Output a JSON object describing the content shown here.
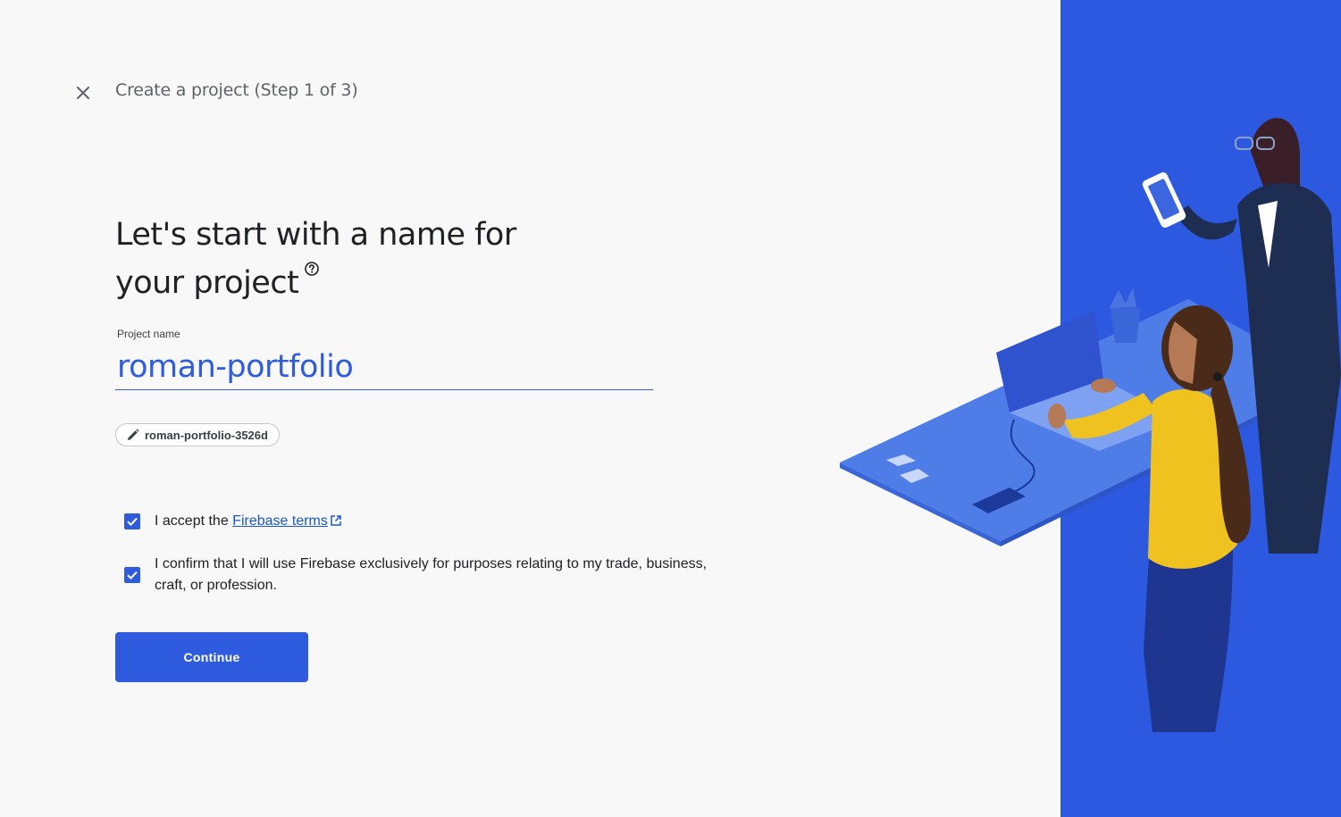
{
  "header": {
    "close_icon": "close-icon",
    "step_title": "Create a project (Step 1 of 3)"
  },
  "main": {
    "heading": "Let's start with a name for your project",
    "help_icon": "help-circle-icon",
    "project_name_label": "Project name",
    "project_name_value": "roman-portfolio",
    "project_id_chip": "roman-portfolio-3526d",
    "project_id_icon": "pencil-icon"
  },
  "checkboxes": [
    {
      "checked": true,
      "text_before": "I accept the ",
      "link": "Firebase terms",
      "link_icon": "open-in-new-icon"
    },
    {
      "checked": true,
      "text": "I confirm that I will use Firebase exclusively for purposes relating to my trade, business, craft, or profession."
    }
  ],
  "continue_label": "Continue",
  "colors": {
    "accent": "#2f5bdf",
    "panel": "#2d59e0",
    "background": "#f8f8f8"
  }
}
